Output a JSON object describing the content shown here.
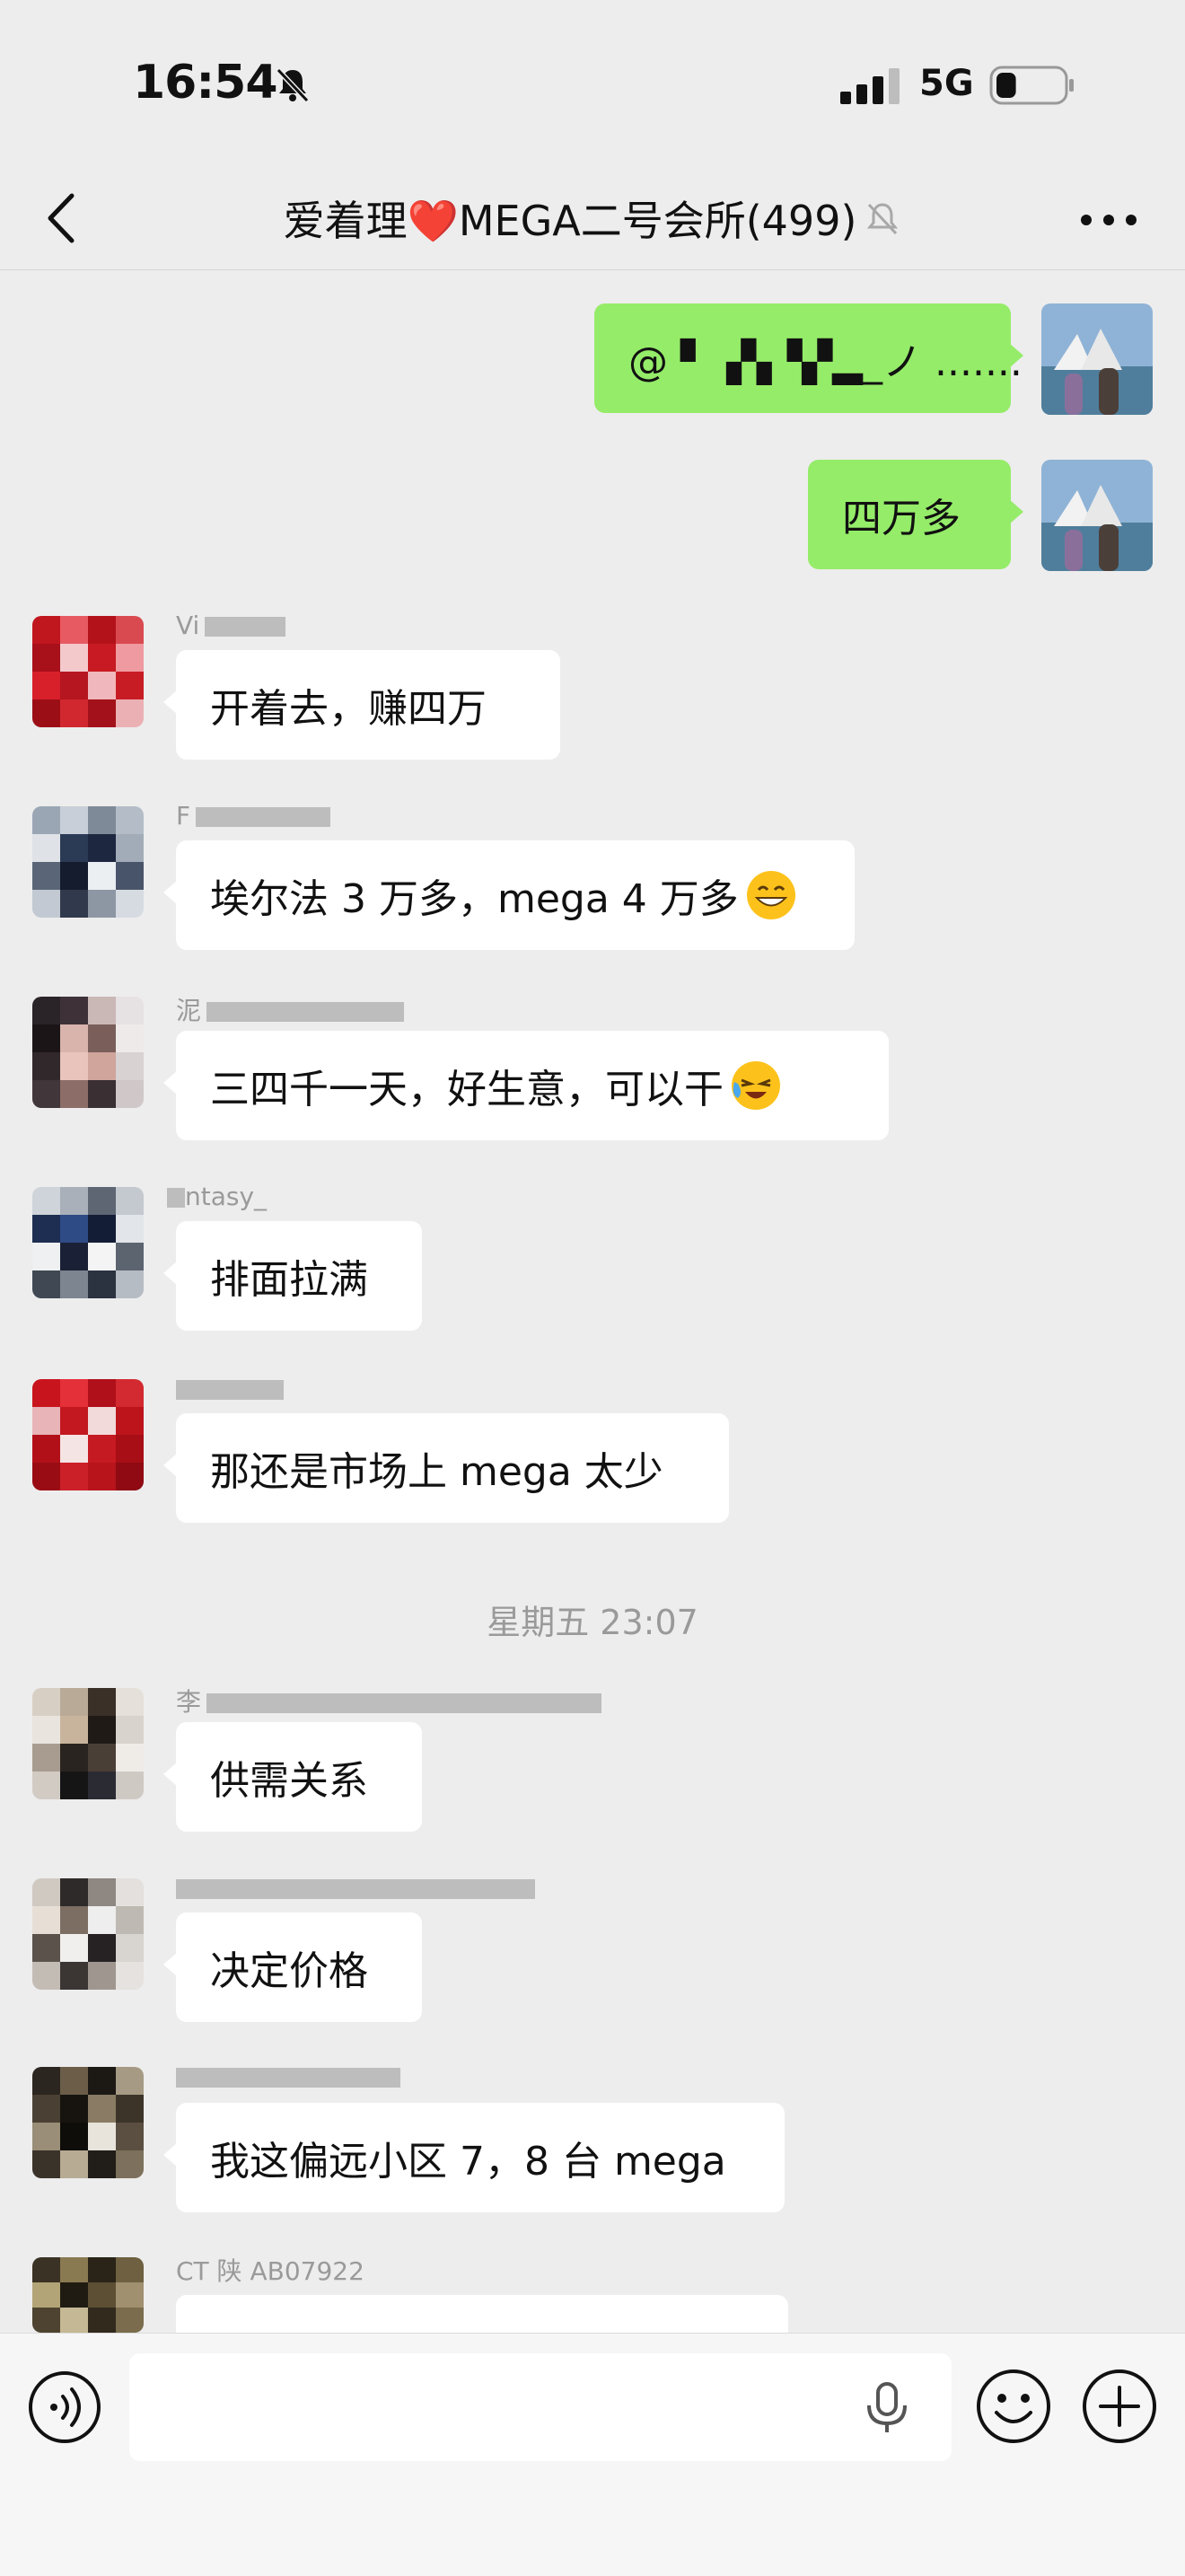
{
  "status_bar": {
    "time": "16:54",
    "network": "5G",
    "battery_percent": 30
  },
  "nav": {
    "title": "爱着理❤️MEGA二号会所(499)"
  },
  "messages": [
    {
      "side": "out",
      "text": "@ ▘▗▚▝▞▂_ノ ......."
    },
    {
      "side": "out",
      "text": "四万多"
    },
    {
      "side": "in",
      "sender": "Vi",
      "text": "开着去，赚四万"
    },
    {
      "side": "in",
      "sender": "F",
      "text": "埃尔法 3 万多，mega 4 万多"
    },
    {
      "side": "in",
      "sender": "泥",
      "text": "三四千一天，好生意，可以干"
    },
    {
      "side": "in",
      "sender": "ntasy_",
      "text": "排面拉满"
    },
    {
      "side": "in",
      "sender": "",
      "text": "那还是市场上 mega 太少"
    },
    {
      "side": "in",
      "sender": "李",
      "text": "供需关系"
    },
    {
      "side": "in",
      "sender": "",
      "text": "决定价格"
    },
    {
      "side": "in",
      "sender": "",
      "text": "我这偏远小区 7，8 台 mega"
    },
    {
      "side": "in",
      "sender": "CT 陕 AB07922",
      "text": ""
    }
  ],
  "timestamp": "星期五 23:07",
  "input": {
    "placeholder": ""
  },
  "icons": {
    "back": "chevron-left-icon",
    "mute": "bell-off-icon",
    "more": "more-dots-icon",
    "voice": "voice-icon",
    "mic": "mic-icon",
    "emoji": "emoji-icon",
    "plus": "plus-icon"
  },
  "colors": {
    "background": "#ededed",
    "bubble_out": "#95ec69",
    "bubble_in": "#ffffff"
  }
}
